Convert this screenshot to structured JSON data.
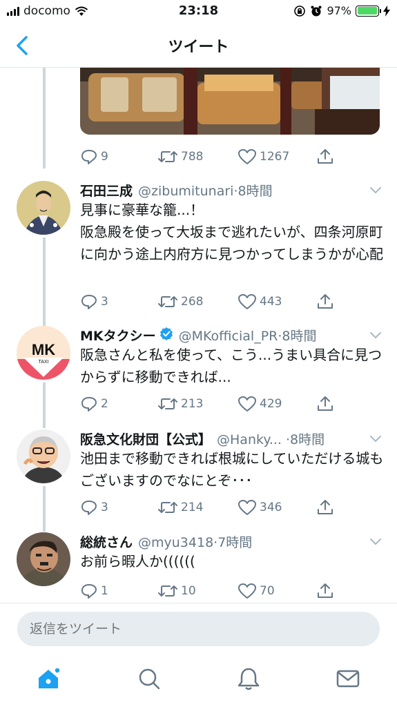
{
  "status_bar": {
    "carrier": "docomo",
    "time": "23:18",
    "battery_pct": "97%",
    "battery_level": 0.97,
    "battery_color": "#4cd964"
  },
  "nav": {
    "title": "ツイート",
    "back_icon": "chevron-left-icon"
  },
  "colors": {
    "accent": "#1da1f2",
    "muted": "#657786",
    "divider": "#e1e8ed"
  },
  "top_tweet_actions": {
    "replies": "9",
    "retweets": "788",
    "likes": "1267"
  },
  "tweets": [
    {
      "name": "石田三成",
      "handle": "@zibumitunari",
      "separator": "·",
      "time": "8時間",
      "text": "見事に豪華な籠...！\n阪急殿を使って大坂まで逃れたいが、四条河原町に向かう途上内府方に見つかってしまうかが心配",
      "replies": "3",
      "retweets": "268",
      "likes": "443"
    },
    {
      "name": "MKタクシー",
      "verified": true,
      "handle": "@MKofficial_PR",
      "separator": "·",
      "time": "8時間",
      "avatar_text": "MK",
      "avatar_subtext": "TAXI",
      "text": "阪急さんと私を使って、こう...うまい具合に見つからずに移動できれば...",
      "replies": "2",
      "retweets": "213",
      "likes": "429"
    },
    {
      "name": "阪急文化財団【公式】",
      "handle": "@Hanky...",
      "separator": "·",
      "time": "8時間",
      "text": "池田まで移動できれば根城にしていただける城もございますのでなにとぞ･･･",
      "replies": "3",
      "retweets": "214",
      "likes": "346"
    },
    {
      "name": "総統さん",
      "handle": "@myu3418",
      "separator": "·",
      "time": "7時間",
      "text": "お前ら暇人か((((((",
      "replies": "1",
      "retweets": "10",
      "likes": "70"
    }
  ],
  "reply": {
    "placeholder": "返信をツイート"
  },
  "tabs": [
    "home-icon",
    "search-icon",
    "notifications-icon",
    "messages-icon"
  ]
}
